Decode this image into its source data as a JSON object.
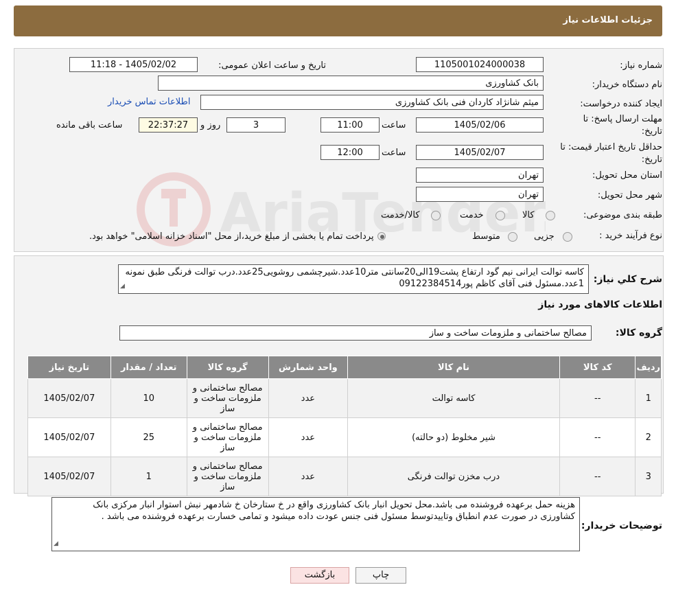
{
  "header": {
    "title": "جزئیات اطلاعات نیاز"
  },
  "form": {
    "need_number_label": "شماره نیاز:",
    "need_number": "1105001024000038",
    "announce_label": "تاریخ و ساعت اعلان عمومی:",
    "announce_value": "1405/02/02 - 11:18",
    "buyer_org_label": "نام دستگاه خریدار:",
    "buyer_org": "بانک کشاورزی",
    "creator_label": "ایجاد کننده درخواست:",
    "creator": "میثم شانژاد کاردان فنی بانک کشاورزی",
    "contact_link": "اطلاعات تماس خریدار",
    "reply_deadline_label_1": "مهلت ارسال پاسخ: تا",
    "reply_deadline_label_2": "تاریخ:",
    "reply_date": "1405/02/06",
    "time_label": "ساعت",
    "reply_time": "11:00",
    "days_value": "3",
    "days_label": "روز و",
    "remaining_time": "22:37:27",
    "remaining_label": "ساعت باقی مانده",
    "price_validity_label_1": "حداقل تاریخ اعتبار قیمت: تا",
    "price_validity_label_2": "تاریخ:",
    "price_date": "1405/02/07",
    "price_time": "12:00",
    "province_label": "استان محل تحویل:",
    "province": "تهران",
    "city_label": "شهر محل تحویل:",
    "city": "تهران",
    "category_label": "طبقه بندی موضوعی:",
    "category_options": [
      "کالا",
      "خدمت",
      "کالا/خدمت"
    ],
    "process_label": "نوع فرآیند خرید :",
    "process_options": [
      "جزیی",
      "متوسط"
    ],
    "process_note": "پرداخت تمام یا بخشی از مبلغ خرید،از محل \"اسناد خزانه اسلامی\" خواهد بود."
  },
  "description": {
    "label": "شرح کلي نياز:",
    "text": "کاسه توالت ایرانی نیم گود ارتفاع پشت19الی20سانتی متر10عدد.شیرچشمی روشویی25عدد.درب توالت فرنگی طبق نمونه 1عدد.مسئول فنی آقای کاظم پور09122384514"
  },
  "goods_info_title": "اطلاعات کالاهای مورد نیاز",
  "goods_group": {
    "label": "گروه کالا:",
    "value": "مصالح ساختمانی و ملزومات ساخت و ساز"
  },
  "table": {
    "headers": [
      "ردیف",
      "کد کالا",
      "نام کالا",
      "واحد شمارش",
      "گروه کالا",
      "تعداد / مقدار",
      "تاریخ نیاز"
    ],
    "rows": [
      {
        "row": "1",
        "code": "--",
        "name": "کاسه توالت",
        "unit": "عدد",
        "group": "مصالح ساختمانی و ملزومات ساخت و ساز",
        "qty": "10",
        "date": "1405/02/07"
      },
      {
        "row": "2",
        "code": "--",
        "name": "شیر مخلوط (دو حالته)",
        "unit": "عدد",
        "group": "مصالح ساختمانی و ملزومات ساخت و ساز",
        "qty": "25",
        "date": "1405/02/07"
      },
      {
        "row": "3",
        "code": "--",
        "name": "درب مخزن توالت فرنگی",
        "unit": "عدد",
        "group": "مصالح ساختمانی و ملزومات ساخت و ساز",
        "qty": "1",
        "date": "1405/02/07"
      }
    ]
  },
  "buyer_notes": {
    "label": "توضیحات خریدار:",
    "text": "هزینه حمل برعهده فروشنده می باشد.محل تحویل انبار بانک کشاورزی واقع در خ ستارخان خ شادمهر نبش استوار انبار مرکزی بانک کشاورزی در صورت عدم انطباق وتاییدتوسط مسئول فنی جنس عودت داده میشود و تمامی خسارت برعهده فروشنده می باشد ."
  },
  "buttons": {
    "print": "چاپ",
    "back": "بازگشت"
  },
  "watermark": {
    "text": "AriaTender.neT"
  }
}
